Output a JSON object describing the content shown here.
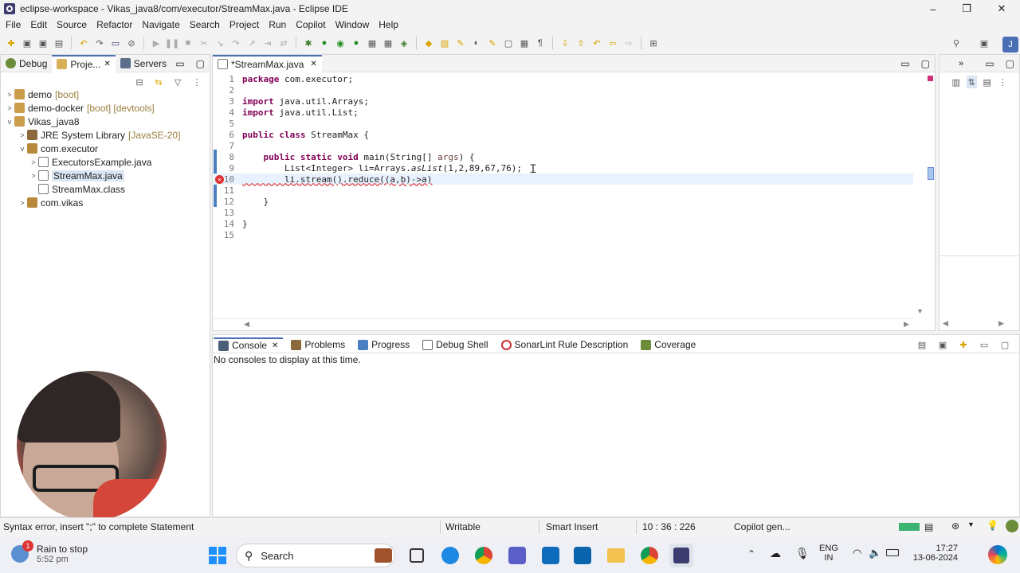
{
  "window": {
    "title": "eclipse-workspace - Vikas_java8/com/executor/StreamMax.java - Eclipse IDE",
    "min": "–",
    "max": "❐",
    "close": "✕"
  },
  "menu": [
    "File",
    "Edit",
    "Source",
    "Refactor",
    "Navigate",
    "Search",
    "Project",
    "Run",
    "Copilot",
    "Window",
    "Help"
  ],
  "left_tabs": [
    {
      "label": "Debug"
    },
    {
      "label": "Proje..."
    },
    {
      "label": "Servers"
    }
  ],
  "tree": [
    {
      "twisty": ">",
      "label": "demo",
      "deco": "[boot]",
      "indent": 0
    },
    {
      "twisty": ">",
      "label": "demo-docker",
      "deco": "[boot] [devtools]",
      "indent": 0
    },
    {
      "twisty": "v",
      "label": "Vikas_java8",
      "deco": "",
      "indent": 0
    },
    {
      "twisty": ">",
      "label": "JRE System Library",
      "deco": "[JavaSE-20]",
      "indent": 1
    },
    {
      "twisty": "v",
      "label": "com.executor",
      "deco": "",
      "indent": 1
    },
    {
      "twisty": ">",
      "label": "ExecutorsExample.java",
      "deco": "",
      "indent": 2
    },
    {
      "twisty": ">",
      "label": "StreamMax.java",
      "deco": "",
      "indent": 2
    },
    {
      "twisty": "",
      "label": "StreamMax.class",
      "deco": "",
      "indent": 2
    },
    {
      "twisty": ">",
      "label": "com.vikas",
      "deco": "",
      "indent": 1
    }
  ],
  "editor": {
    "tab": "*StreamMax.java",
    "lines": [
      {
        "n": "1",
        "text": "package com.executor;"
      },
      {
        "n": "2",
        "text": ""
      },
      {
        "n": "3",
        "text": "import java.util.Arrays;"
      },
      {
        "n": "4",
        "text": "import java.util.List;"
      },
      {
        "n": "5",
        "text": ""
      },
      {
        "n": "6",
        "text": "public class StreamMax {"
      },
      {
        "n": "7",
        "text": ""
      },
      {
        "n": "8",
        "text": "    public static void main(String[] args) {"
      },
      {
        "n": "9",
        "text": "        List<Integer> li=Arrays.asList(1,2,89,67,76);"
      },
      {
        "n": "10",
        "text": "        li.stream().reduce((a,b)->a)"
      },
      {
        "n": "11",
        "text": ""
      },
      {
        "n": "12",
        "text": "    }"
      },
      {
        "n": "13",
        "text": ""
      },
      {
        "n": "14",
        "text": "}"
      },
      {
        "n": "15",
        "text": ""
      }
    ]
  },
  "bottom_tabs": [
    {
      "label": "Console"
    },
    {
      "label": "Problems"
    },
    {
      "label": "Progress"
    },
    {
      "label": "Debug Shell"
    },
    {
      "label": "SonarLint Rule Description"
    },
    {
      "label": "Coverage"
    }
  ],
  "console_msg": "No consoles to display at this time.",
  "status": {
    "message": "Syntax error, insert \";\" to complete Statement",
    "writable": "Writable",
    "insert": "Smart Insert",
    "position": "10 : 36 : 226",
    "copilot": "Copilot gen..."
  },
  "taskbar": {
    "weather_title": "Rain to stop",
    "weather_time": "5:52 pm",
    "weather_badge": "1",
    "search": "Search",
    "lang1": "ENG",
    "lang2": "IN",
    "time": "17:27",
    "date": "13-06-2024"
  }
}
